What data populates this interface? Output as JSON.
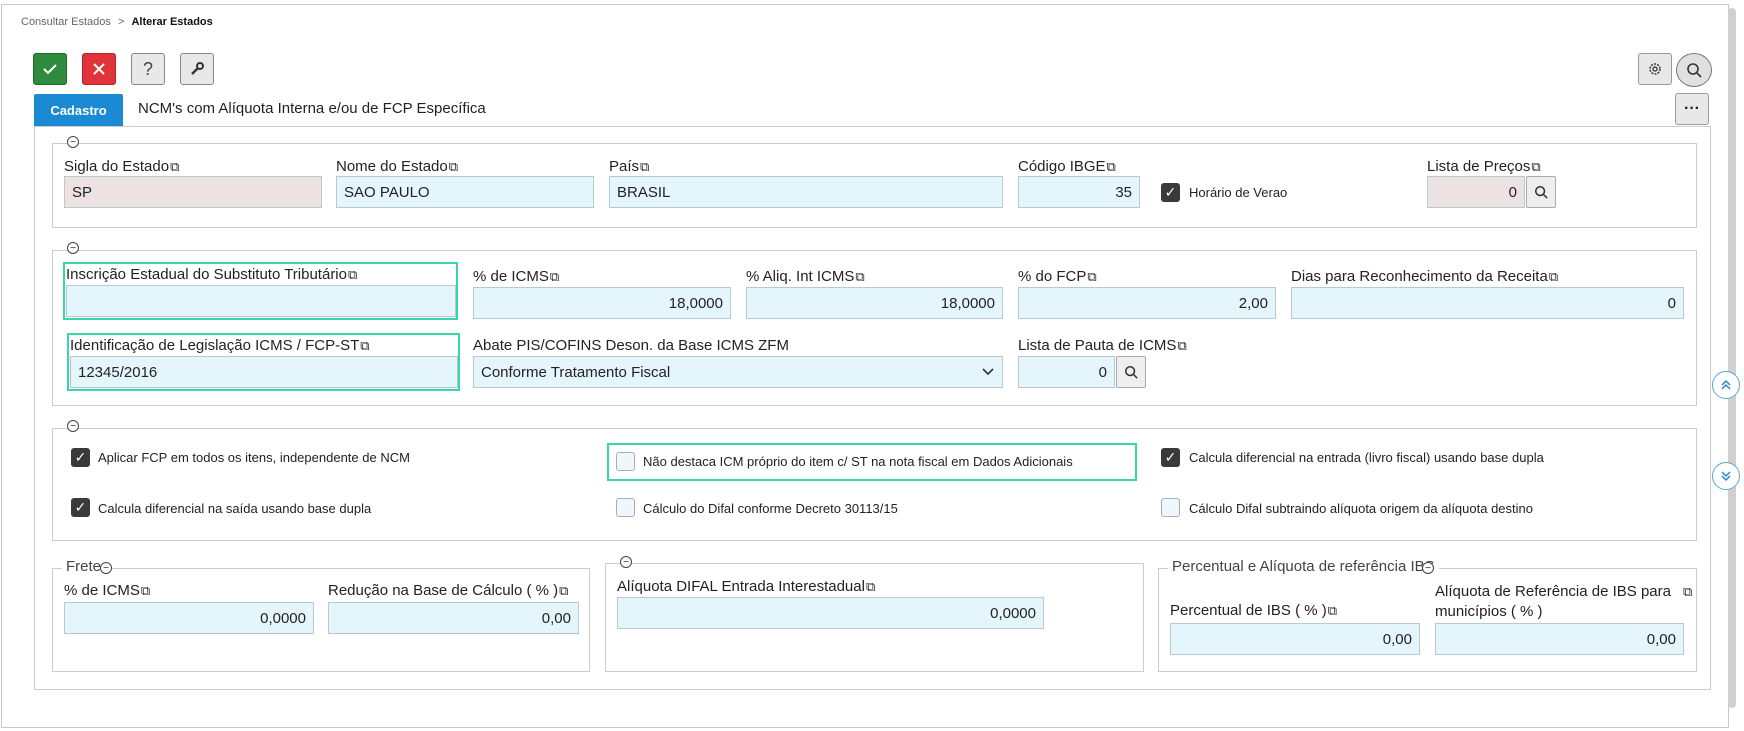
{
  "breadcrumb": {
    "parent": "Consultar Estados",
    "sep": ">",
    "current": "Alterar Estados"
  },
  "toolbar": {
    "confirm": "✓",
    "cancel": "✕",
    "help": "?"
  },
  "tabs": {
    "cadastro": "Cadastro",
    "ncm": "NCM's com Alíquota Interna e/ou de FCP Específica",
    "more": "···"
  },
  "group1": {
    "sigla_label": "Sigla do Estado",
    "sigla_value": "SP",
    "nome_label": "Nome do Estado",
    "nome_value": "SAO PAULO",
    "pais_label": "País",
    "pais_value": "BRASIL",
    "ibge_label": "Código IBGE",
    "ibge_value": "35",
    "horario_label": "Horário de Verao",
    "lista_precos_label": "Lista de Preços",
    "lista_precos_value": "0"
  },
  "group2": {
    "ie_label": "Inscrição Estadual do Substituto Tributário",
    "ie_value": "",
    "icms_label": "% de ICMS",
    "icms_value": "18,0000",
    "aliq_label": "% Aliq. Int ICMS",
    "aliq_value": "18,0000",
    "fcp_label": "% do FCP",
    "fcp_value": "2,00",
    "dias_label": "Dias para Reconhecimento da Receita",
    "dias_value": "0",
    "legis_label": "Identificação de Legislação ICMS / FCP-ST",
    "legis_value": "12345/2016",
    "abate_label": "Abate PIS/COFINS Deson. da Base ICMS ZFM",
    "abate_value": "Conforme Tratamento Fiscal",
    "pauta_label": "Lista de Pauta de ICMS",
    "pauta_value": "0"
  },
  "group3": {
    "cb1": "Aplicar FCP em todos os itens, independente de NCM",
    "cb2": "Não destaca ICM próprio do item c/ ST na nota fiscal em Dados Adicionais",
    "cb3": "Calcula diferencial na entrada (livro fiscal) usando base dupla",
    "cb4": "Calcula diferencial na saída usando base dupla",
    "cb5": "Cálculo do Difal conforme Decreto 30113/15",
    "cb6": "Cálculo Difal subtraindo alíquota origem da alíquota destino"
  },
  "frete": {
    "legend": "Frete",
    "icms_label": "% de ICMS",
    "icms_value": "0,0000",
    "reducao_label": "Redução na Base de Cálculo ( % )",
    "reducao_value": "0,00"
  },
  "difal": {
    "label": "Alíquota DIFAL Entrada Interestadual",
    "value": "0,0000"
  },
  "ibs": {
    "legend": "Percentual e Alíquota de referência IBS",
    "perc_label": "Percentual de IBS ( % )",
    "perc_value": "0,00",
    "aliq_label_1": "Alíquota de Referência de IBS para",
    "aliq_label_2": "municípios ( % )",
    "aliq_value": "0,00"
  },
  "colors": {
    "accent": "#1a8ad4",
    "confirm": "#2e8b3e",
    "cancel": "#e0333a",
    "highlight": "#38d6a8",
    "input_bg": "#e5f5fc"
  }
}
